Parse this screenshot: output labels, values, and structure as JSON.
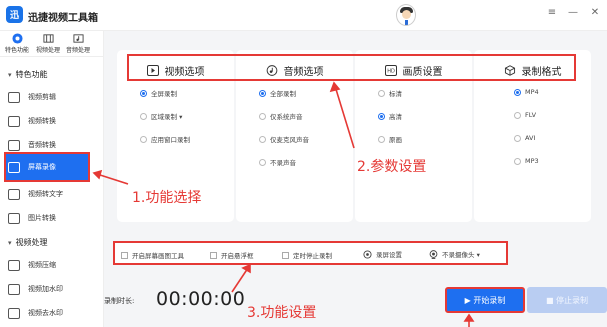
{
  "app": {
    "title": "迅捷视频工具箱",
    "logo_text": "迅"
  },
  "window": {
    "menu_icon": "≡",
    "minimize_icon": "—",
    "close_icon": "✕"
  },
  "topnav": [
    {
      "label": "特色功能",
      "icon": "star-icon"
    },
    {
      "label": "视频处理",
      "icon": "film-icon"
    },
    {
      "label": "音频处理",
      "icon": "music-icon"
    }
  ],
  "sidebar": {
    "group1_title": "特色功能",
    "group1_items": [
      "视频剪辑",
      "视频转换",
      "音频转换",
      "屏幕录像",
      "视频转文字",
      "图片转换"
    ],
    "group2_title": "视频处理",
    "group2_items": [
      "视频压缩",
      "视频加水印",
      "视频去水印"
    ],
    "active_item": "屏幕录像"
  },
  "panels": {
    "video": {
      "title": "视频选项",
      "options": [
        "全屏录制",
        "区域录制 ▾",
        "应用窗口录制"
      ],
      "selected": 0
    },
    "audio": {
      "title": "音频选项",
      "options": [
        "全部录制",
        "仅系统声音",
        "仅麦克风声音",
        "不录声音"
      ],
      "selected": 0
    },
    "quality": {
      "title": "画质设置",
      "options": [
        "标清",
        "高清",
        "原画"
      ],
      "selected": 1
    },
    "format": {
      "title": "录制格式",
      "options": [
        "MP4",
        "FLV",
        "AVI",
        "MP3"
      ],
      "selected": 0
    }
  },
  "bottom_options": {
    "brush": "开启屏幕画图工具",
    "float": "开启悬浮框",
    "timer": "定时停止录制",
    "record_settings": "录屏设置",
    "camera": "不录摄像头 ▾"
  },
  "recording": {
    "time_label": "录制时长:",
    "time_value": "00:00:00",
    "start_label": "▶ 开始录制",
    "stop_label": "■ 停止录制"
  },
  "annotations": {
    "feature": "1.功能选择",
    "params": "2.参数设置",
    "functions": "3.功能设置"
  },
  "colors": {
    "accent": "#1e6ff0",
    "annotation": "#e53935"
  }
}
